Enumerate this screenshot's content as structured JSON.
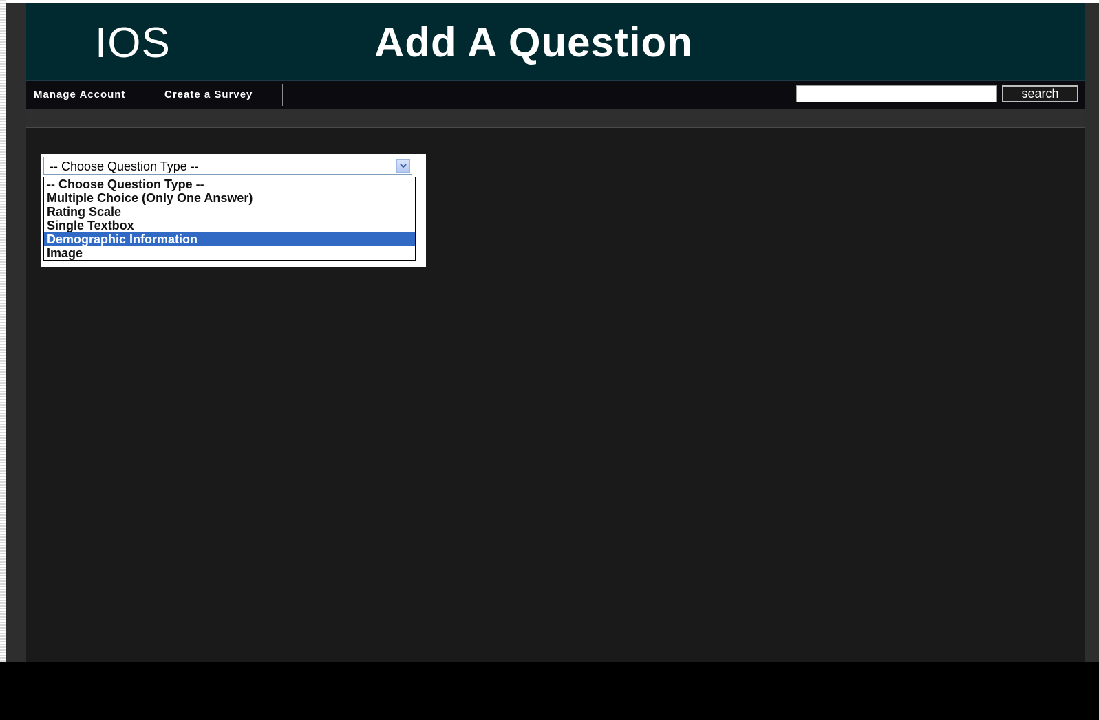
{
  "header": {
    "logo": "IOS",
    "title": "Add A Question"
  },
  "nav": {
    "items": [
      {
        "label": "Manage Account"
      },
      {
        "label": "Create a Survey"
      }
    ]
  },
  "search": {
    "value": "",
    "button_label": "search"
  },
  "question_type_select": {
    "selected_value": "-- Choose Question Type --",
    "highlighted_option": "Demographic Information",
    "options": [
      "-- Choose Question Type --",
      "Multiple Choice (Only One Answer)",
      "Rating Scale",
      "Single Textbox",
      "Demographic Information",
      "Image"
    ]
  },
  "colors": {
    "header_bg": "#012a30",
    "content_bg": "#1a1a1a",
    "highlight": "#316ac5"
  },
  "icons": {
    "select_arrow": "chevron-down-icon"
  }
}
